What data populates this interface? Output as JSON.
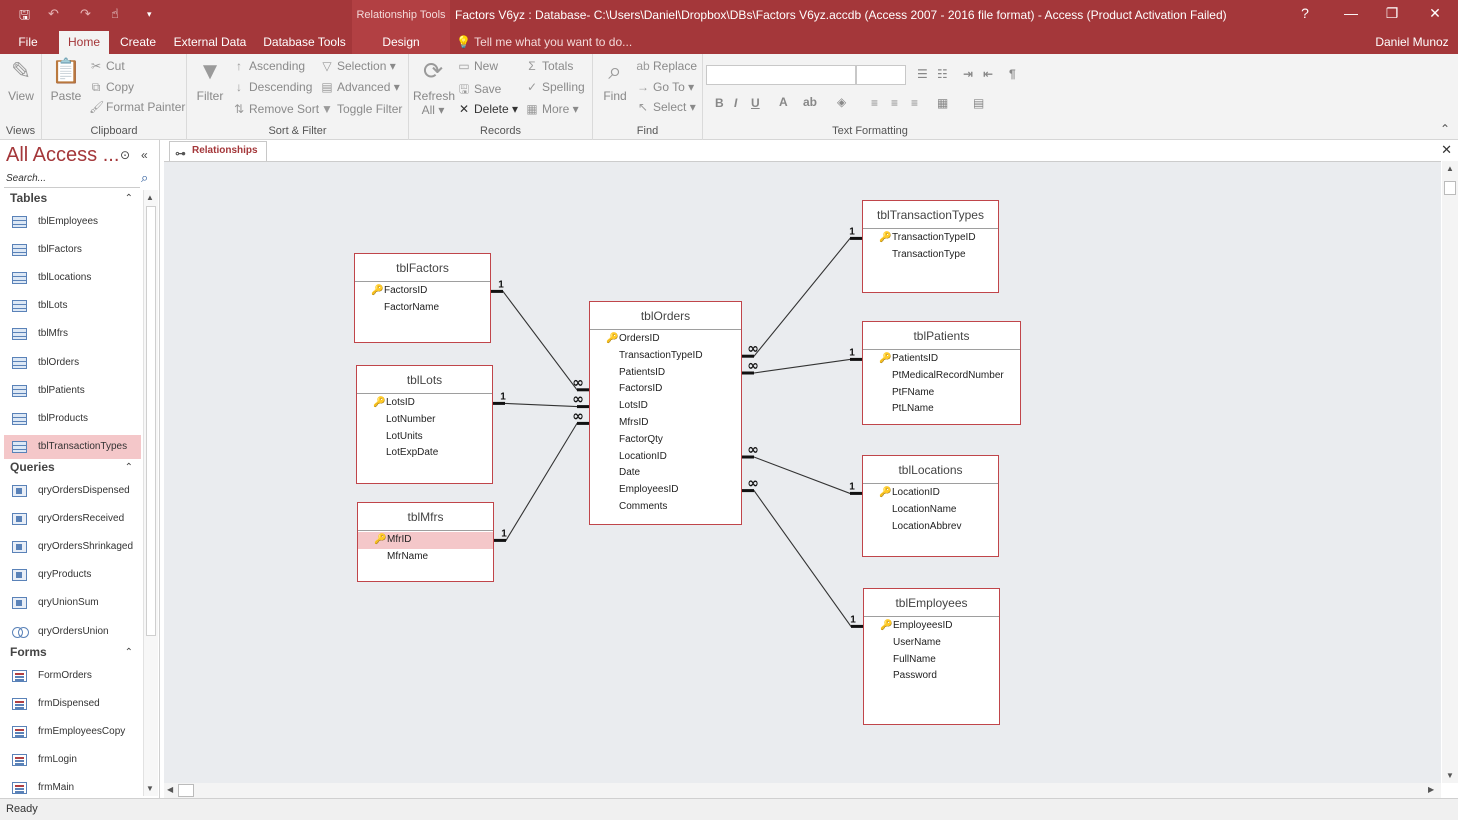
{
  "window": {
    "context_tab_label": "Relationship Tools",
    "title": "Factors V6yz : Database- C:\\Users\\Daniel\\Dropbox\\DBs\\Factors V6yz.accdb (Access 2007 - 2016 file format) - Access (Product Activation Failed)",
    "help": "?",
    "minimize": "—",
    "restore": "❐",
    "close": "✕",
    "user": "Daniel Munoz"
  },
  "ribbon_tabs": [
    "File",
    "Home",
    "Create",
    "External Data",
    "Database Tools",
    "Design"
  ],
  "tell_me": "Tell me what you want to do...",
  "ribbon": {
    "views": {
      "view": "View",
      "label": "Views"
    },
    "clipboard": {
      "paste": "Paste",
      "cut": "Cut",
      "copy": "Copy",
      "format_painter": "Format Painter",
      "label": "Clipboard"
    },
    "sort_filter": {
      "filter": "Filter",
      "ascending": "Ascending",
      "descending": "Descending",
      "remove_sort": "Remove Sort",
      "selection": "Selection",
      "advanced": "Advanced",
      "toggle_filter": "Toggle Filter",
      "label": "Sort & Filter"
    },
    "records": {
      "refresh": "Refresh",
      "refresh_all": "All",
      "new": "New",
      "save": "Save",
      "delete": "Delete",
      "totals": "Totals",
      "spelling": "Spelling",
      "more": "More",
      "label": "Records"
    },
    "find": {
      "find": "Find",
      "replace": "Replace",
      "goto": "Go To",
      "select": "Select",
      "label": "Find"
    },
    "text_formatting": {
      "label": "Text Formatting"
    }
  },
  "nav": {
    "title": "All Access ...",
    "search_placeholder": "Search...",
    "sections": [
      {
        "name": "Tables",
        "items": [
          "tblEmployees",
          "tblFactors",
          "tblLocations",
          "tblLots",
          "tblMfrs",
          "tblOrders",
          "tblPatients",
          "tblProducts",
          "tblTransactionTypes"
        ],
        "selected": "tblTransactionTypes"
      },
      {
        "name": "Queries",
        "items": [
          "qryOrdersDispensed",
          "qryOrdersReceived",
          "qryOrdersShrinkaged",
          "qryProducts",
          "qryUnionSum",
          "qryOrdersUnion"
        ]
      },
      {
        "name": "Forms",
        "items": [
          "FormOrders",
          "frmDispensed",
          "frmEmployeesCopy",
          "frmLogin",
          "frmMain"
        ]
      }
    ]
  },
  "document": {
    "tab_label": "Relationships",
    "close": "✕"
  },
  "tables": [
    {
      "name": "tblFactors",
      "fields": [
        "FactorsID",
        "FactorName"
      ],
      "pk": "FactorsID"
    },
    {
      "name": "tblLots",
      "fields": [
        "LotsID",
        "LotNumber",
        "LotUnits",
        "LotExpDate"
      ],
      "pk": "LotsID"
    },
    {
      "name": "tblMfrs",
      "fields": [
        "MfrID",
        "MfrName"
      ],
      "pk": "MfrID",
      "selected_field": "MfrID"
    },
    {
      "name": "tblOrders",
      "fields": [
        "OrdersID",
        "TransactionTypeID",
        "PatientsID",
        "FactorsID",
        "LotsID",
        "MfrsID",
        "FactorQty",
        "LocationID",
        "Date",
        "EmployeesID",
        "Comments"
      ],
      "pk": "OrdersID"
    },
    {
      "name": "tblTransactionTypes",
      "fields": [
        "TransactionTypeID",
        "TransactionType"
      ],
      "pk": "TransactionTypeID"
    },
    {
      "name": "tblPatients",
      "fields": [
        "PatientsID",
        "PtMedicalRecordNumber",
        "PtFName",
        "PtLName"
      ],
      "pk": "PatientsID"
    },
    {
      "name": "tblLocations",
      "fields": [
        "LocationID",
        "LocationName",
        "LocationAbbrev"
      ],
      "pk": "LocationID"
    },
    {
      "name": "tblEmployees",
      "fields": [
        "EmployeesID",
        "UserName",
        "FullName",
        "Password"
      ],
      "pk": "EmployeesID"
    }
  ],
  "relationships": [
    {
      "one": "tblFactors.FactorsID",
      "many": "tblOrders.FactorsID",
      "one_label": "1",
      "many_label": "∞"
    },
    {
      "one": "tblLots.LotsID",
      "many": "tblOrders.LotsID",
      "one_label": "1",
      "many_label": "∞"
    },
    {
      "one": "tblMfrs.MfrID",
      "many": "tblOrders.MfrsID",
      "one_label": "1",
      "many_label": "∞"
    },
    {
      "one": "tblTransactionTypes.TransactionTypeID",
      "many": "tblOrders.TransactionTypeID",
      "one_label": "1",
      "many_label": "∞"
    },
    {
      "one": "tblPatients.PatientsID",
      "many": "tblOrders.PatientsID",
      "one_label": "1",
      "many_label": "∞"
    },
    {
      "one": "tblLocations.LocationID",
      "many": "tblOrders.LocationID",
      "one_label": "1",
      "many_label": "∞"
    },
    {
      "one": "tblEmployees.EmployeesID",
      "many": "tblOrders.EmployeesID",
      "one_label": "1",
      "many_label": "∞"
    }
  ],
  "status": "Ready",
  "colors": {
    "accent": "#a4373a",
    "selection": "#f4c7c9",
    "canvas": "#eaecef"
  }
}
